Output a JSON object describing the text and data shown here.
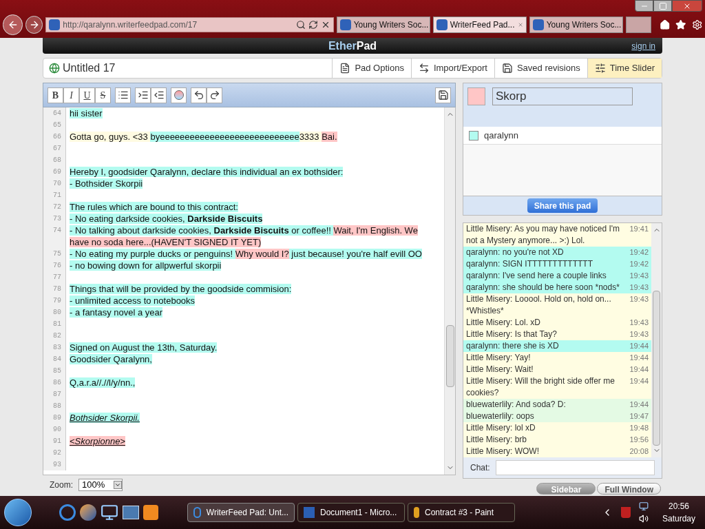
{
  "browser": {
    "url": "http://qaralynn.writerfeedpad.com/17",
    "tabs": [
      {
        "label": "Young Writers Soc...",
        "selected": false
      },
      {
        "label": "WriterFeed Pad...",
        "selected": true
      },
      {
        "label": "Young Writers Soc...",
        "selected": false
      }
    ]
  },
  "header": {
    "logo": [
      {
        "text": "Ether",
        "kind": "accent"
      },
      {
        "text": "Pad",
        "kind": "plain"
      }
    ],
    "sign_in": "sign in"
  },
  "pad": {
    "title": "Untitled 17",
    "menu": [
      {
        "label": "Pad Options",
        "selected": false
      },
      {
        "label": "Import/Export",
        "selected": false
      },
      {
        "label": "Saved revisions",
        "selected": false
      },
      {
        "label": "Time Slider",
        "selected": true
      }
    ]
  },
  "toolbar": {
    "format_buttons": [
      "B",
      "I",
      "U",
      "S"
    ]
  },
  "editor": {
    "lines": [
      {
        "number": "64",
        "segments": [
          {
            "text": "hii sister",
            "color": "#b3fbf0",
            "kind": "plain"
          }
        ]
      },
      {
        "number": "65"
      },
      {
        "number": "66",
        "segments": [
          {
            "text": "Gotta go, guys. <33 ",
            "color": "#fffbe2",
            "kind": "plain"
          },
          {
            "text": "byeeeeeeeeeeeeeeeeeeeeeeeeeeee",
            "color": "#b3fbf0",
            "kind": "plain"
          },
          {
            "text": "3333 ",
            "color": "#fffbe2",
            "kind": "plain"
          },
          {
            "text": "Bai.",
            "color": "#ffc6c6",
            "kind": "plain"
          }
        ]
      },
      {
        "number": "67"
      },
      {
        "number": "68"
      },
      {
        "number": "69",
        "segments": [
          {
            "text": "Hereby I, goodsider Qaralynn, declare this individual an ex bothsider:",
            "color": "#b3fbf0",
            "kind": "plain"
          }
        ]
      },
      {
        "number": "70",
        "segments": [
          {
            "text": "- Bothsider Skorpii",
            "color": "#b3fbf0",
            "kind": "plain"
          }
        ]
      },
      {
        "number": "71"
      },
      {
        "number": "72",
        "segments": [
          {
            "text": "The rules which are bound to this contract:",
            "color": "#b3fbf0",
            "kind": "plain"
          }
        ]
      },
      {
        "number": "73",
        "segments": [
          {
            "text": "- No eating darkside cookies, ",
            "color": "#b3fbf0",
            "kind": "plain"
          },
          {
            "text": "Darkside Biscuits",
            "color": "#b3fbf0",
            "kind": "bold"
          }
        ]
      },
      {
        "number": "74",
        "segments": [
          {
            "text": "- No talking about darkside cookies, ",
            "color": "#b3fbf0",
            "kind": "plain"
          },
          {
            "text": "Darkside Biscuits",
            "color": "#b3fbf0",
            "kind": "bold"
          },
          {
            "text": " or coffee!! ",
            "color": "#b3fbf0",
            "kind": "plain"
          },
          {
            "text": "Wait, I'm English. We have no soda here...(HAVEN'T SIGNED IT YET)",
            "color": "#ffc6c6",
            "kind": "plain"
          }
        ]
      },
      {
        "number": "75",
        "segments": [
          {
            "text": "- No eating my purple ducks or penguins! ",
            "color": "#b3fbf0",
            "kind": "plain"
          },
          {
            "text": "Why would I?",
            "color": "#ffc6c6",
            "kind": "plain"
          },
          {
            "text": " just because! you're half evill OO",
            "color": "#b3fbf0",
            "kind": "plain"
          }
        ]
      },
      {
        "number": "76",
        "segments": [
          {
            "text": "- no bowing down for allpwerful skorpii",
            "color": "#b3fbf0",
            "kind": "plain"
          }
        ]
      },
      {
        "number": "77"
      },
      {
        "number": "78",
        "segments": [
          {
            "text": "Things that will be provided by the goodside commision:",
            "color": "#b3fbf0",
            "kind": "plain"
          }
        ]
      },
      {
        "number": "79",
        "segments": [
          {
            "text": "- unlimited access to notebooks ",
            "color": "#b3fbf0",
            "kind": "plain"
          }
        ]
      },
      {
        "number": "80",
        "segments": [
          {
            "text": "- a fantasy novel a year",
            "color": "#b3fbf0",
            "kind": "plain"
          }
        ]
      },
      {
        "number": "81"
      },
      {
        "number": "82"
      },
      {
        "number": "83",
        "segments": [
          {
            "text": "Signed on August the 13th, Saturday.",
            "color": "#b3fbf0",
            "kind": "plain"
          }
        ]
      },
      {
        "number": "84",
        "segments": [
          {
            "text": "Goodsider Qaralynn,",
            "color": "#b3fbf0",
            "kind": "plain"
          }
        ]
      },
      {
        "number": "85"
      },
      {
        "number": "86",
        "segments": [
          {
            "text": "Q,a.r.a//.//l/y/nn.,",
            "color": "#b3fbf0",
            "kind": "plain"
          }
        ]
      },
      {
        "number": "87"
      },
      {
        "number": "88"
      },
      {
        "number": "89",
        "segments": [
          {
            "text": "Bothsider Skorpii.",
            "color": "#b3fbf0",
            "kind": "italic-underline"
          }
        ]
      },
      {
        "number": "90"
      },
      {
        "number": "91",
        "segments": [
          {
            "text": " <Skorpionne>",
            "color": "#ffc6c6",
            "kind": "italic-underline"
          }
        ]
      },
      {
        "number": "92"
      },
      {
        "number": "93"
      }
    ]
  },
  "zoom": {
    "label": "Zoom:",
    "value": "100%"
  },
  "users": {
    "me": {
      "name": "Skorp",
      "color": "#ffc6c6"
    },
    "others": [
      {
        "name": "qaralynn",
        "color": "#b3fbf0"
      }
    ],
    "share": "Share this pad"
  },
  "chat": {
    "messages": [
      {
        "text": "Little Misery: As you may have noticed I'm not a Mystery anymore... >:) Lol.",
        "time": "19:41",
        "color": "#fffde2"
      },
      {
        "text": "qaralynn: no you're not XD",
        "time": "19:42",
        "color": "#b3fbf0"
      },
      {
        "text": "qaralynn: SIGN ITTTTTTTTTTTTT",
        "time": "19:42",
        "color": "#b3fbf0"
      },
      {
        "text": "qaralynn: I've send here a couple links",
        "time": "19:43",
        "color": "#b3fbf0"
      },
      {
        "text": "qaralynn: she should be here soon *nods*",
        "time": "19:43",
        "color": "#b3fbf0"
      },
      {
        "text": "Little Misery: Looool. Hold on, hold on... *Whistles*",
        "time": "19:43",
        "color": "#fffde2"
      },
      {
        "text": "Little Misery: Lol. xD",
        "time": "19:43",
        "color": "#fffde2"
      },
      {
        "text": "Little Misery: Is that Tay?",
        "time": "19:43",
        "color": "#fffde2"
      },
      {
        "text": "qaralynn: there she is XD",
        "time": "19:44",
        "color": "#b3fbf0"
      },
      {
        "text": "Little Misery: Yay!",
        "time": "19:44",
        "color": "#fffde2"
      },
      {
        "text": "Little Misery: Wait!",
        "time": "19:44",
        "color": "#fffde2"
      },
      {
        "text": "Little Misery: Will the bright side offer me cookies?",
        "time": "19:44",
        "color": "#fffde2"
      },
      {
        "text": "bluewaterlily: And soda? D:",
        "time": "19:44",
        "color": "#e4fae4"
      },
      {
        "text": "bluewaterlily: oops",
        "time": "19:47",
        "color": "#e4fae4"
      },
      {
        "text": "Little Misery: lol xD",
        "time": "19:48",
        "color": "#fffde2"
      },
      {
        "text": "Little Misery: brb",
        "time": "19:56",
        "color": "#fffde2"
      },
      {
        "text": "Little Misery: WOW!",
        "time": "20:08",
        "color": "#fffde2"
      }
    ],
    "input_label": "Chat:"
  },
  "view_buttons": [
    {
      "label": "Sidebar",
      "selected": true
    },
    {
      "label": "Full Window",
      "selected": false
    }
  ],
  "taskbar": {
    "items": [
      {
        "label": "WriterFeed Pad: Unt...",
        "selected": true
      },
      {
        "label": "Document1 - Micro...",
        "selected": false
      },
      {
        "label": "Contract #3 - Paint",
        "selected": false
      }
    ],
    "time": "20:56",
    "day": "Saturday"
  }
}
